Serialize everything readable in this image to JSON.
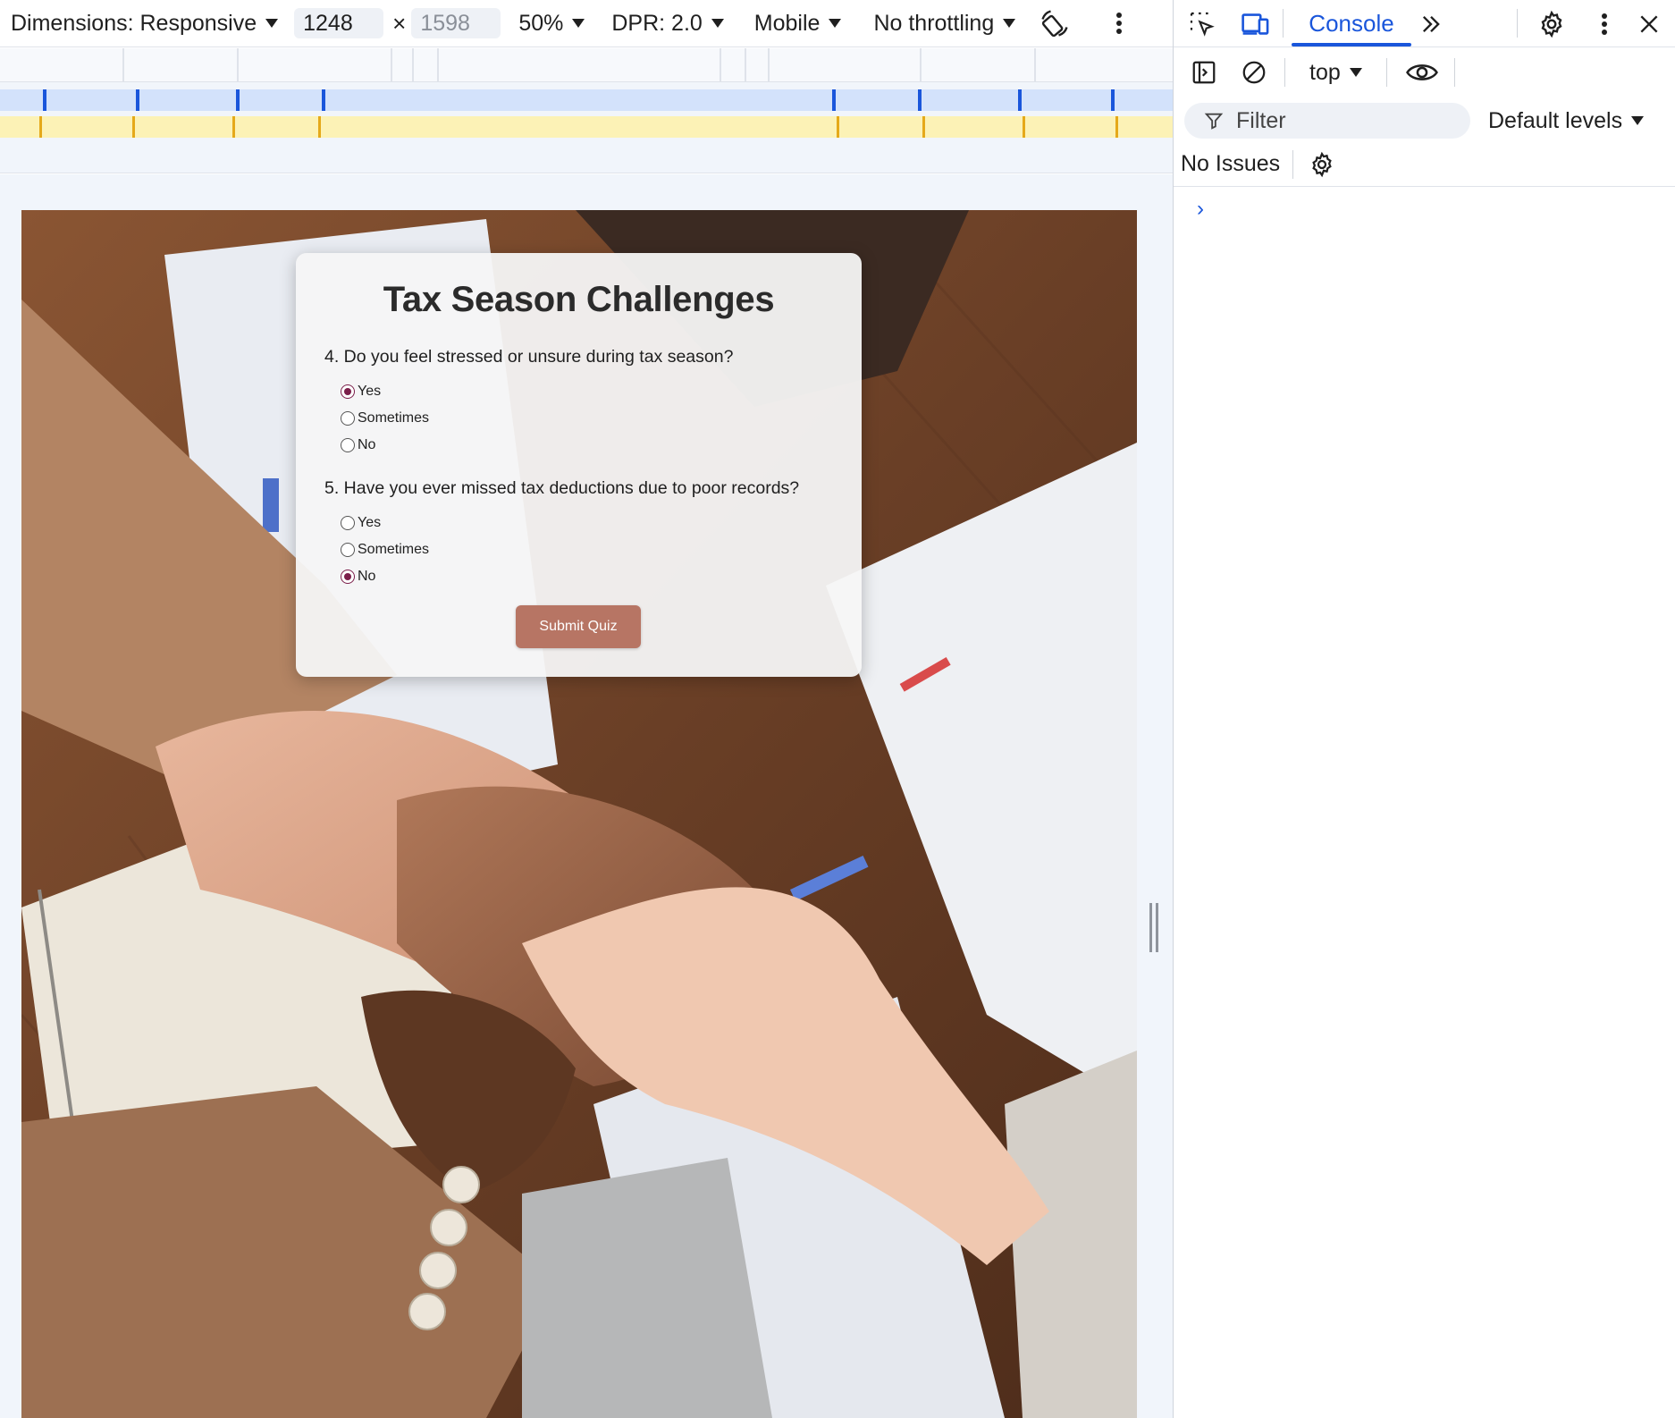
{
  "device_toolbar": {
    "dimensions_label": "Dimensions: Responsive",
    "width_value": "1248",
    "times_symbol": "×",
    "height_placeholder": "1598",
    "zoom": "50%",
    "dpr": "DPR: 2.0",
    "device_mode": "Mobile",
    "throttling": "No throttling"
  },
  "quiz": {
    "title": "Tax Season Challenges",
    "questions": [
      {
        "text": "4. Do you feel stressed or unsure during tax season?",
        "options": [
          "Yes",
          "Sometimes",
          "No"
        ],
        "selected": "Yes"
      },
      {
        "text": "5. Have you ever missed tax deductions due to poor records?",
        "options": [
          "Yes",
          "Sometimes",
          "No"
        ],
        "selected": "No"
      }
    ],
    "submit_label": "Submit Quiz",
    "accent_color": "#7b1e4a",
    "button_color": "#b77564"
  },
  "devtools": {
    "active_tab": "Console",
    "context": "top",
    "filter_placeholder": "Filter",
    "levels": "Default levels",
    "issues": "No Issues",
    "prompt_symbol": "›",
    "accent_color": "#1a56db"
  }
}
